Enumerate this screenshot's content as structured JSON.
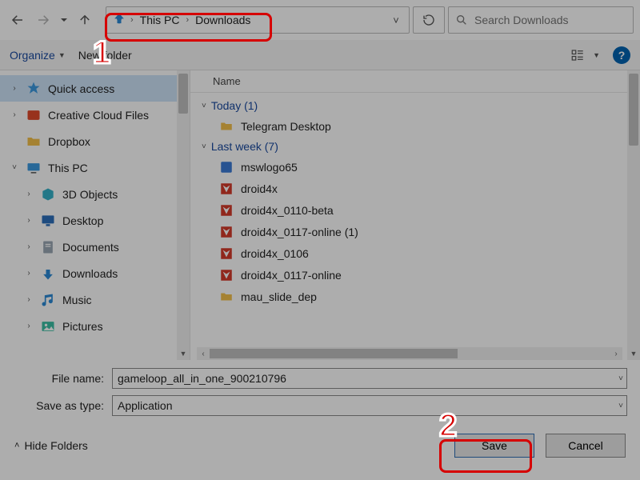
{
  "nav": {
    "breadcrumb": [
      {
        "label": "This PC"
      },
      {
        "label": "Downloads"
      }
    ],
    "search_placeholder": "Search Downloads"
  },
  "toolbar": {
    "organize_label": "Organize",
    "newfolder_label": "New folder",
    "help_glyph": "?"
  },
  "tree": [
    {
      "label": "Quick access",
      "icon": "star",
      "twist": ">",
      "level": 0,
      "selected": true
    },
    {
      "label": "Creative Cloud Files",
      "icon": "cc",
      "twist": ">",
      "level": 0
    },
    {
      "label": "Dropbox",
      "icon": "folder",
      "twist": "",
      "level": 0
    },
    {
      "label": "This PC",
      "icon": "pc",
      "twist": "v",
      "level": 0
    },
    {
      "label": "3D Objects",
      "icon": "cube",
      "twist": ">",
      "level": 1
    },
    {
      "label": "Desktop",
      "icon": "desktop",
      "twist": ">",
      "level": 1
    },
    {
      "label": "Documents",
      "icon": "doc",
      "twist": ">",
      "level": 1
    },
    {
      "label": "Downloads",
      "icon": "down",
      "twist": ">",
      "level": 1
    },
    {
      "label": "Music",
      "icon": "music",
      "twist": ">",
      "level": 1
    },
    {
      "label": "Pictures",
      "icon": "pic",
      "twist": ">",
      "level": 1
    }
  ],
  "list": {
    "header_name": "Name",
    "groups": [
      {
        "title": "Today (1)",
        "items": [
          {
            "name": "Telegram Desktop",
            "icon": "folder"
          }
        ]
      },
      {
        "title": "Last week (7)",
        "items": [
          {
            "name": "mswlogo65",
            "icon": "app-blue"
          },
          {
            "name": "droid4x",
            "icon": "app-red"
          },
          {
            "name": "droid4x_0110-beta",
            "icon": "app-red"
          },
          {
            "name": "droid4x_0117-online (1)",
            "icon": "app-red"
          },
          {
            "name": "droid4x_0106",
            "icon": "app-red"
          },
          {
            "name": "droid4x_0117-online",
            "icon": "app-red"
          },
          {
            "name": "mau_slide_dep",
            "icon": "folder"
          }
        ]
      }
    ]
  },
  "form": {
    "filename_label": "File name:",
    "filename_value": "gameloop_all_in_one_900210796",
    "saveas_label": "Save as type:",
    "saveas_value": "Application"
  },
  "footer": {
    "hide_label": "Hide Folders",
    "save_label": "Save",
    "cancel_label": "Cancel"
  },
  "annotations": {
    "num1": "1",
    "num2": "2"
  }
}
